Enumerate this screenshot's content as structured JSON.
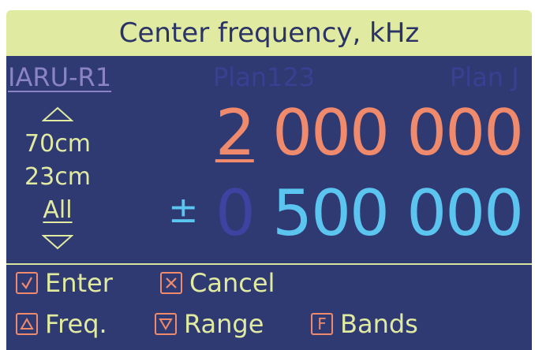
{
  "title": "Center frequency, kHz",
  "plans": [
    {
      "label": "IARU-R1",
      "active": true
    },
    {
      "label": "Plan123",
      "active": false
    },
    {
      "label": "Plan J",
      "active": false
    }
  ],
  "bands": {
    "items": [
      "70cm",
      "23cm",
      "All"
    ],
    "selected": "All",
    "up_icon": "triangle-up-icon",
    "down_icon": "triangle-down-icon"
  },
  "frequency": {
    "cursor_digit": "2",
    "rest": " 000 000"
  },
  "range": {
    "prefix": "±",
    "dim_digit": "0",
    "value": " 500 000"
  },
  "actions": {
    "enter": {
      "key": "check-box-icon",
      "label": "Enter"
    },
    "cancel": {
      "key": "x-box-icon",
      "label": "Cancel"
    },
    "freq": {
      "key": "triangle-up-box-icon",
      "label": "Freq."
    },
    "range": {
      "key": "triangle-down-box-icon",
      "label": "Range"
    },
    "bands": {
      "key": "F",
      "label": "Bands"
    }
  },
  "colors": {
    "background": "#2f3a73",
    "title_bg": "#e0eaa0",
    "frequency": "#f08a6c",
    "range": "#5bc4ef",
    "text": "#e0eaa0",
    "inactive_plan": "#3b3f92"
  }
}
